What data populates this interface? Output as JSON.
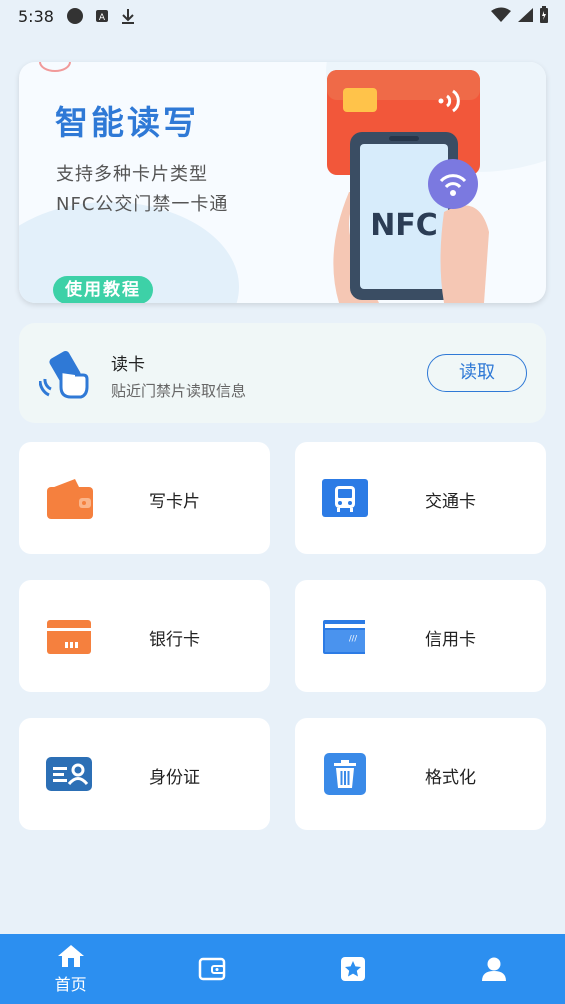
{
  "status_bar": {
    "time": "5:38"
  },
  "banner": {
    "title": "智能读写",
    "subtitle_1": "支持多种卡片类型",
    "subtitle_2": "NFC公交门禁一卡通",
    "tutorial_button": "使用教程",
    "art_text": "NFC"
  },
  "read_panel": {
    "title": "读卡",
    "description": "贴近门禁片读取信息",
    "button_label": "读取"
  },
  "cards": [
    {
      "label": "写卡片",
      "icon": "wallet-icon",
      "color": "#f5803e"
    },
    {
      "label": "交通卡",
      "icon": "bus-icon",
      "color": "#2c7be5"
    },
    {
      "label": "银行卡",
      "icon": "bank-card-icon",
      "color": "#f5803e"
    },
    {
      "label": "信用卡",
      "icon": "credit-card-icon",
      "color": "#2c7be5"
    },
    {
      "label": "身份证",
      "icon": "id-card-icon",
      "color": "#2c6fb5"
    },
    {
      "label": "格式化",
      "icon": "trash-icon",
      "color": "#3a8ae8"
    }
  ],
  "bottom_nav": {
    "items": [
      {
        "label": "首页",
        "icon": "home-icon"
      },
      {
        "label": "",
        "icon": "wallet-icon"
      },
      {
        "label": "",
        "icon": "star-icon"
      },
      {
        "label": "",
        "icon": "user-icon"
      }
    ]
  },
  "colors": {
    "accent": "#2f79d6",
    "nav_bg": "#2c8ff0",
    "tutorial_bg": "#3dd1a7"
  }
}
